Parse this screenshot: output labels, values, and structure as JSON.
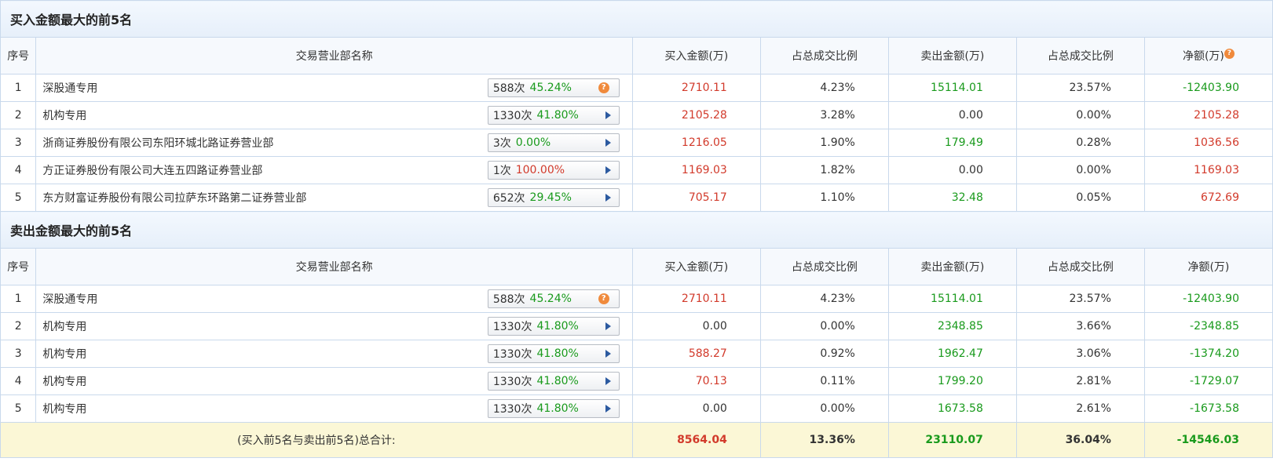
{
  "buy_section": {
    "title": "买入金额最大的前5名",
    "headers": [
      "序号",
      "交易营业部名称",
      "买入金额(万)",
      "占总成交比例",
      "卖出金额(万)",
      "占总成交比例",
      "净额(万)"
    ],
    "rows": [
      {
        "idx": "1",
        "name": "深股通专用",
        "count": "588次",
        "pct": "45.24%",
        "pct_color": "green",
        "btn": "help",
        "buy": "2710.11",
        "buy_pct": "4.23%",
        "sell": "15114.01",
        "sell_pct": "23.57%",
        "net": "-12403.90",
        "net_color": "green"
      },
      {
        "idx": "2",
        "name": "机构专用",
        "count": "1330次",
        "pct": "41.80%",
        "pct_color": "green",
        "btn": "arrow",
        "buy": "2105.28",
        "buy_pct": "3.28%",
        "sell": "0.00",
        "sell_pct": "0.00%",
        "net": "2105.28",
        "net_color": "red"
      },
      {
        "idx": "3",
        "name": "浙商证券股份有限公司东阳环城北路证券营业部",
        "count": "3次",
        "pct": "0.00%",
        "pct_color": "green",
        "btn": "arrow",
        "buy": "1216.05",
        "buy_pct": "1.90%",
        "sell": "179.49",
        "sell_pct": "0.28%",
        "net": "1036.56",
        "net_color": "red"
      },
      {
        "idx": "4",
        "name": "方正证券股份有限公司大连五四路证券营业部",
        "count": "1次",
        "pct": "100.00%",
        "pct_color": "red",
        "btn": "arrow",
        "buy": "1169.03",
        "buy_pct": "1.82%",
        "sell": "0.00",
        "sell_pct": "0.00%",
        "net": "1169.03",
        "net_color": "red"
      },
      {
        "idx": "5",
        "name": "东方财富证券股份有限公司拉萨东环路第二证券营业部",
        "count": "652次",
        "pct": "29.45%",
        "pct_color": "green",
        "btn": "arrow",
        "buy": "705.17",
        "buy_pct": "1.10%",
        "sell": "32.48",
        "sell_pct": "0.05%",
        "net": "672.69",
        "net_color": "red"
      }
    ]
  },
  "sell_section": {
    "title": "卖出金额最大的前5名",
    "headers": [
      "序号",
      "交易营业部名称",
      "买入金额(万)",
      "占总成交比例",
      "卖出金额(万)",
      "占总成交比例",
      "净额(万)"
    ],
    "rows": [
      {
        "idx": "1",
        "name": "深股通专用",
        "count": "588次",
        "pct": "45.24%",
        "pct_color": "green",
        "btn": "help",
        "buy": "2710.11",
        "buy_pct": "4.23%",
        "sell": "15114.01",
        "sell_pct": "23.57%",
        "net": "-12403.90",
        "net_color": "green"
      },
      {
        "idx": "2",
        "name": "机构专用",
        "count": "1330次",
        "pct": "41.80%",
        "pct_color": "green",
        "btn": "arrow",
        "buy": "0.00",
        "buy_pct": "0.00%",
        "sell": "2348.85",
        "sell_pct": "3.66%",
        "net": "-2348.85",
        "net_color": "green"
      },
      {
        "idx": "3",
        "name": "机构专用",
        "count": "1330次",
        "pct": "41.80%",
        "pct_color": "green",
        "btn": "arrow",
        "buy": "588.27",
        "buy_pct": "0.92%",
        "sell": "1962.47",
        "sell_pct": "3.06%",
        "net": "-1374.20",
        "net_color": "green"
      },
      {
        "idx": "4",
        "name": "机构专用",
        "count": "1330次",
        "pct": "41.80%",
        "pct_color": "green",
        "btn": "arrow",
        "buy": "70.13",
        "buy_pct": "0.11%",
        "sell": "1799.20",
        "sell_pct": "2.81%",
        "net": "-1729.07",
        "net_color": "green"
      },
      {
        "idx": "5",
        "name": "机构专用",
        "count": "1330次",
        "pct": "41.80%",
        "pct_color": "green",
        "btn": "arrow",
        "buy": "0.00",
        "buy_pct": "0.00%",
        "sell": "1673.58",
        "sell_pct": "2.61%",
        "net": "-1673.58",
        "net_color": "green"
      }
    ]
  },
  "total": {
    "label": "(买入前5名与卖出前5名)总合计:",
    "buy": "8564.04",
    "buy_pct": "13.36%",
    "sell": "23110.07",
    "sell_pct": "36.04%",
    "net": "-14546.03"
  },
  "icons": {
    "help": "question-icon",
    "arrow": "play-arrow-icon"
  },
  "colors": {
    "red": "#d23a2b",
    "green": "#199a1c",
    "border": "#c9d9ec",
    "section_bg": "#e6effa",
    "total_bg": "#fbf7d6",
    "help_icon": "#f08a3c"
  }
}
